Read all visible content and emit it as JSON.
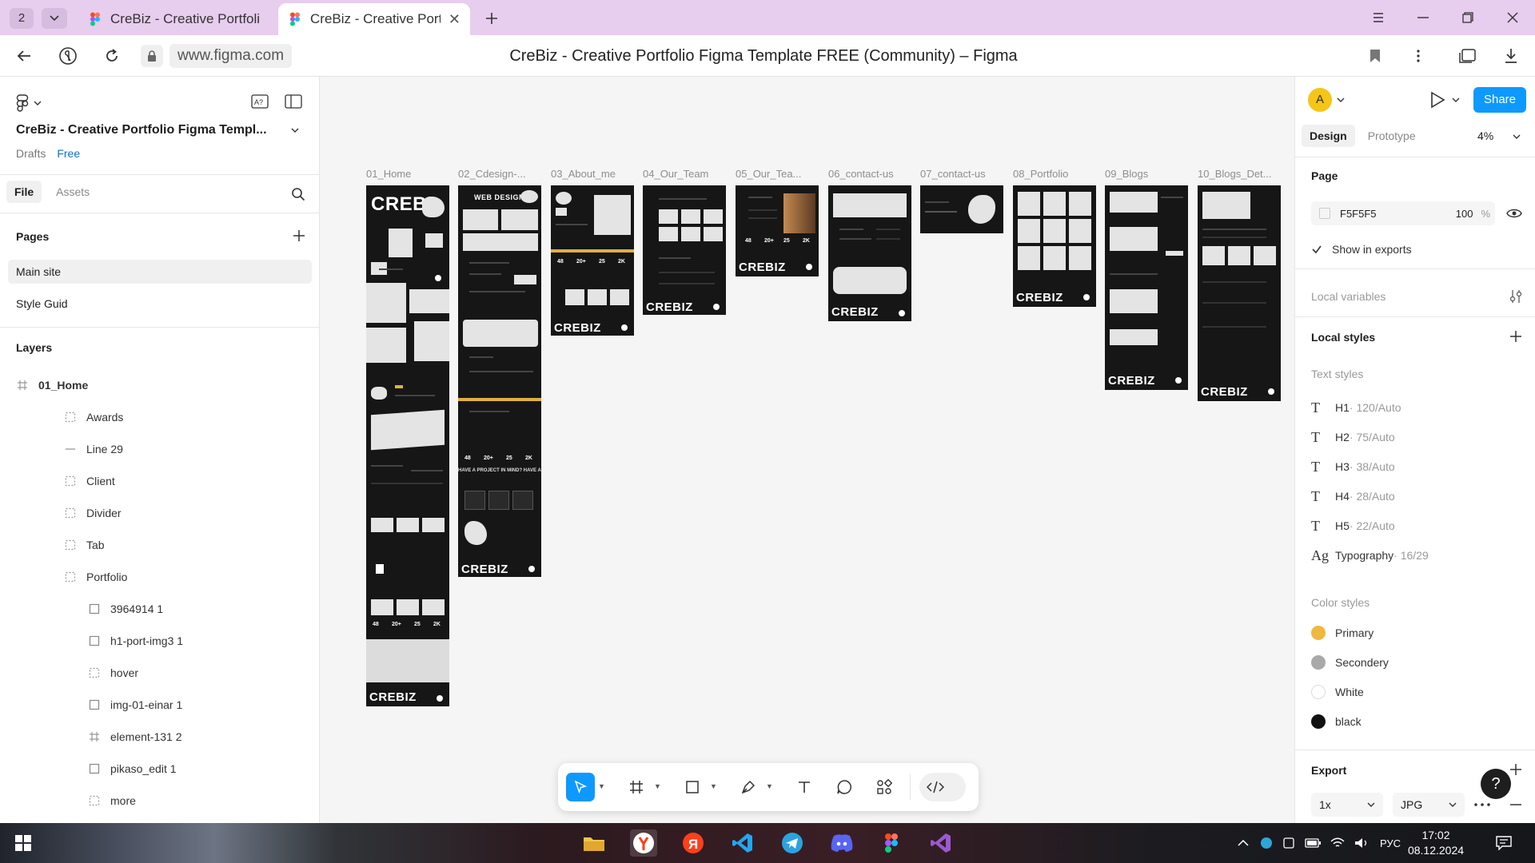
{
  "browser": {
    "tab_count": "2",
    "tabs": [
      {
        "title": "CreBiz - Creative Portfolio Figma"
      },
      {
        "title": "CreBiz - Creative Portfolio Figma"
      }
    ],
    "url": "www.figma.com",
    "page_title": "CreBiz - Creative Portfolio Figma Template FREE (Community) – Figma"
  },
  "left_panel": {
    "project_name": "CreBiz - Creative Portfolio Figma Templ...",
    "location": "Drafts",
    "plan": "Free",
    "tabs": [
      "File",
      "Assets"
    ],
    "pages_heading": "Pages",
    "pages": [
      "Main site",
      "Style Guid"
    ],
    "layers_heading": "Layers",
    "layers": [
      {
        "name": "01_Home",
        "icon": "frame-icon"
      },
      {
        "name": "Awards",
        "icon": "group-icon"
      },
      {
        "name": "Line 29",
        "icon": "line-icon"
      },
      {
        "name": "Client",
        "icon": "group-icon"
      },
      {
        "name": "Divider",
        "icon": "group-icon"
      },
      {
        "name": "Tab",
        "icon": "group-icon"
      },
      {
        "name": "Portfolio",
        "icon": "group-icon"
      },
      {
        "name": "3964914 1",
        "icon": "image-icon"
      },
      {
        "name": "h1-port-img3 1",
        "icon": "image-icon"
      },
      {
        "name": "hover",
        "icon": "group-icon"
      },
      {
        "name": "img-01-einar 1",
        "icon": "image-icon"
      },
      {
        "name": "element-131 2",
        "icon": "frame-icon"
      },
      {
        "name": "pikaso_edit 1",
        "icon": "image-icon"
      },
      {
        "name": "more",
        "icon": "group-icon"
      }
    ]
  },
  "canvas": {
    "frames": [
      {
        "label": "01_Home",
        "brand": "CREBIZ",
        "hero": "CREB"
      },
      {
        "label": "02_Cdesign-...",
        "brand": "CREBIZ",
        "hero": "WEB DESIGN"
      },
      {
        "label": "03_About_me",
        "brand": "CREBIZ"
      },
      {
        "label": "04_Our_Team",
        "brand": "CREBIZ"
      },
      {
        "label": "05_Our_Tea...",
        "brand": "CREBIZ"
      },
      {
        "label": "06_contact-us",
        "brand": "CREBIZ"
      },
      {
        "label": "07_contact-us",
        "brand": ""
      },
      {
        "label": "08_Portfolio",
        "brand": "CREBIZ"
      },
      {
        "label": "09_Blogs",
        "brand": "CREBIZ"
      },
      {
        "label": "10_Blogs_Det...",
        "brand": "CREBIZ"
      }
    ],
    "stats": [
      "48",
      "20+",
      "25",
      "2K"
    ],
    "banner_text": "HAVE A PROJECT IN MIND? HAVE A"
  },
  "toolbar": {
    "tools": [
      "move-tool",
      "frame-tool",
      "shape-tool",
      "pen-tool",
      "text-tool",
      "comment-tool",
      "resources-tool",
      "dev-mode-toggle"
    ]
  },
  "right_panel": {
    "avatar_letter": "A",
    "share_label": "Share",
    "tabs": [
      "Design",
      "Prototype"
    ],
    "zoom": "4%",
    "page_heading": "Page",
    "bg_color": "F5F5F5",
    "bg_opacity": "100",
    "bg_opacity_unit": "%",
    "show_in_exports": "Show in exports",
    "local_variables": "Local variables",
    "local_styles": "Local styles",
    "text_styles_heading": "Text styles",
    "text_styles": [
      {
        "icon": "T",
        "name": "H1",
        "meta": " · 120/Auto"
      },
      {
        "icon": "T",
        "name": "H2",
        "meta": " · 75/Auto"
      },
      {
        "icon": "T",
        "name": "H3",
        "meta": " · 38/Auto"
      },
      {
        "icon": "T",
        "name": "H4",
        "meta": " · 28/Auto"
      },
      {
        "icon": "T",
        "name": "H5",
        "meta": " · 22/Auto"
      },
      {
        "icon": "Ag",
        "name": "Typography",
        "meta": " · 16/29"
      }
    ],
    "color_styles_heading": "Color styles",
    "color_styles": [
      {
        "name": "Primary",
        "color": "#F0B83F"
      },
      {
        "name": "Secondery",
        "color": "#A9A9A9"
      },
      {
        "name": "White",
        "color": "#FFFFFF"
      },
      {
        "name": "black",
        "color": "#111111"
      }
    ],
    "export_heading": "Export",
    "export_scale": "1x",
    "export_format": "JPG"
  },
  "taskbar": {
    "language": "РУС",
    "time": "17:02",
    "date": "08.12.2024"
  }
}
